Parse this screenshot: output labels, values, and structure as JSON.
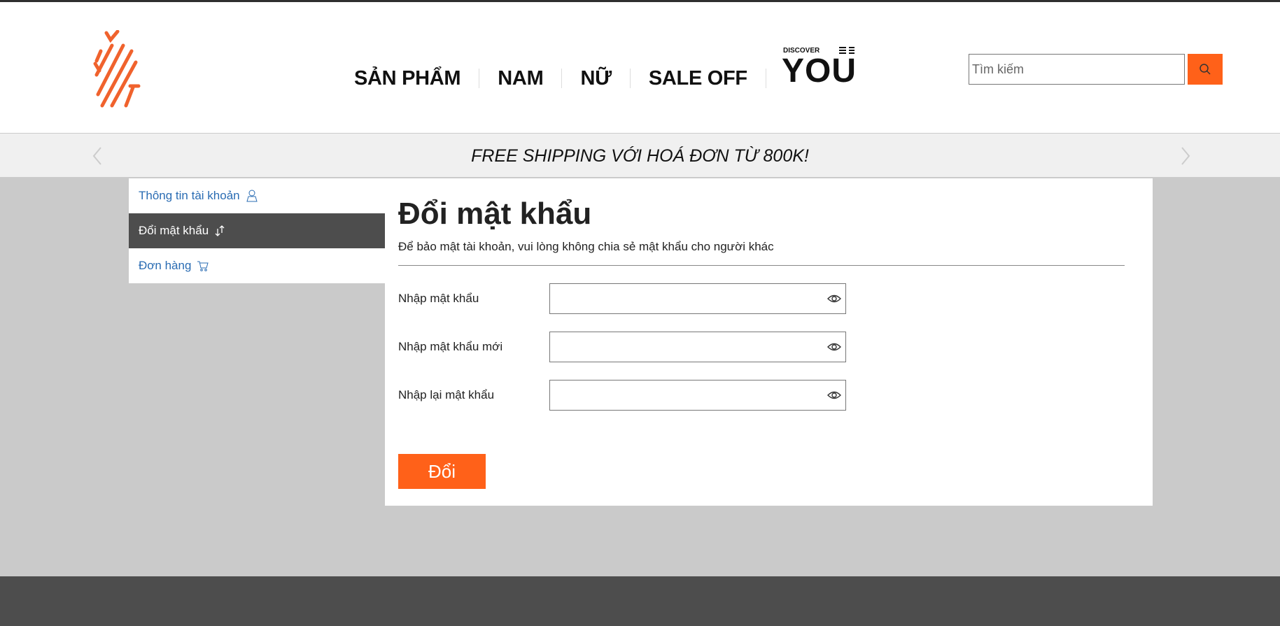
{
  "header": {
    "nav": [
      "SẢN PHẨM",
      "NAM",
      "NỮ",
      "SALE OFF"
    ],
    "discover_logo": "DISCOVER YOU",
    "search": {
      "placeholder": "Tìm kiếm",
      "icon": "search-icon"
    }
  },
  "banner": {
    "text": "FREE SHIPPING VỚI HOÁ ĐƠN TỪ 800K!"
  },
  "sidebar": {
    "items": [
      {
        "label": "Thông tin tài khoản",
        "icon": "user-icon"
      },
      {
        "label": "Đổi mật khẩu",
        "icon": "swap-arrows-icon",
        "active": true
      },
      {
        "label": "Đơn hàng",
        "icon": "cart-icon"
      }
    ]
  },
  "main": {
    "title": "Đổi mật khẩu",
    "subtitle": "Để bảo mật tài khoản, vui lòng không chia sẻ mật khẩu cho người khác",
    "fields": [
      {
        "label": "Nhập mật khẩu",
        "value": ""
      },
      {
        "label": "Nhập mật khẩu mới",
        "value": ""
      },
      {
        "label": "Nhập lại mật khẩu",
        "value": ""
      }
    ],
    "submit_label": "Đổi"
  },
  "colors": {
    "accent": "#ff6119",
    "sidebar_active": "#4d4d4d",
    "link": "#2a6cb3",
    "page_bg": "#cacaca",
    "footer": "#4d4d4d"
  }
}
